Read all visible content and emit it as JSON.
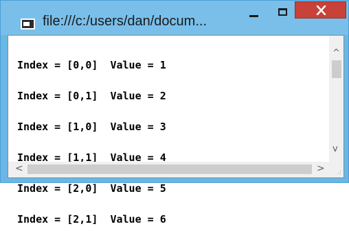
{
  "window": {
    "title": "file:///c:/users/dan/docum...",
    "icon": "console-window-icon",
    "controls": {
      "minimize": "minimize-icon",
      "maximize": "maximize-icon",
      "close": "close-icon"
    }
  },
  "console": {
    "lines": [
      "Index = [0,0]  Value = 1",
      "Index = [0,1]  Value = 2",
      "Index = [1,0]  Value = 3",
      "Index = [1,1]  Value = 4",
      "Index = [2,0]  Value = 5",
      "Index = [2,1]  Value = 6"
    ]
  },
  "scrollbars": {
    "up_arrow": "^",
    "down_arrow": "v",
    "left_arrow": "<",
    "right_arrow": ">",
    "grip": ".:"
  },
  "colors": {
    "titlebar": "#79bfea",
    "close_button": "#c8423a",
    "console_text": "#000000"
  }
}
